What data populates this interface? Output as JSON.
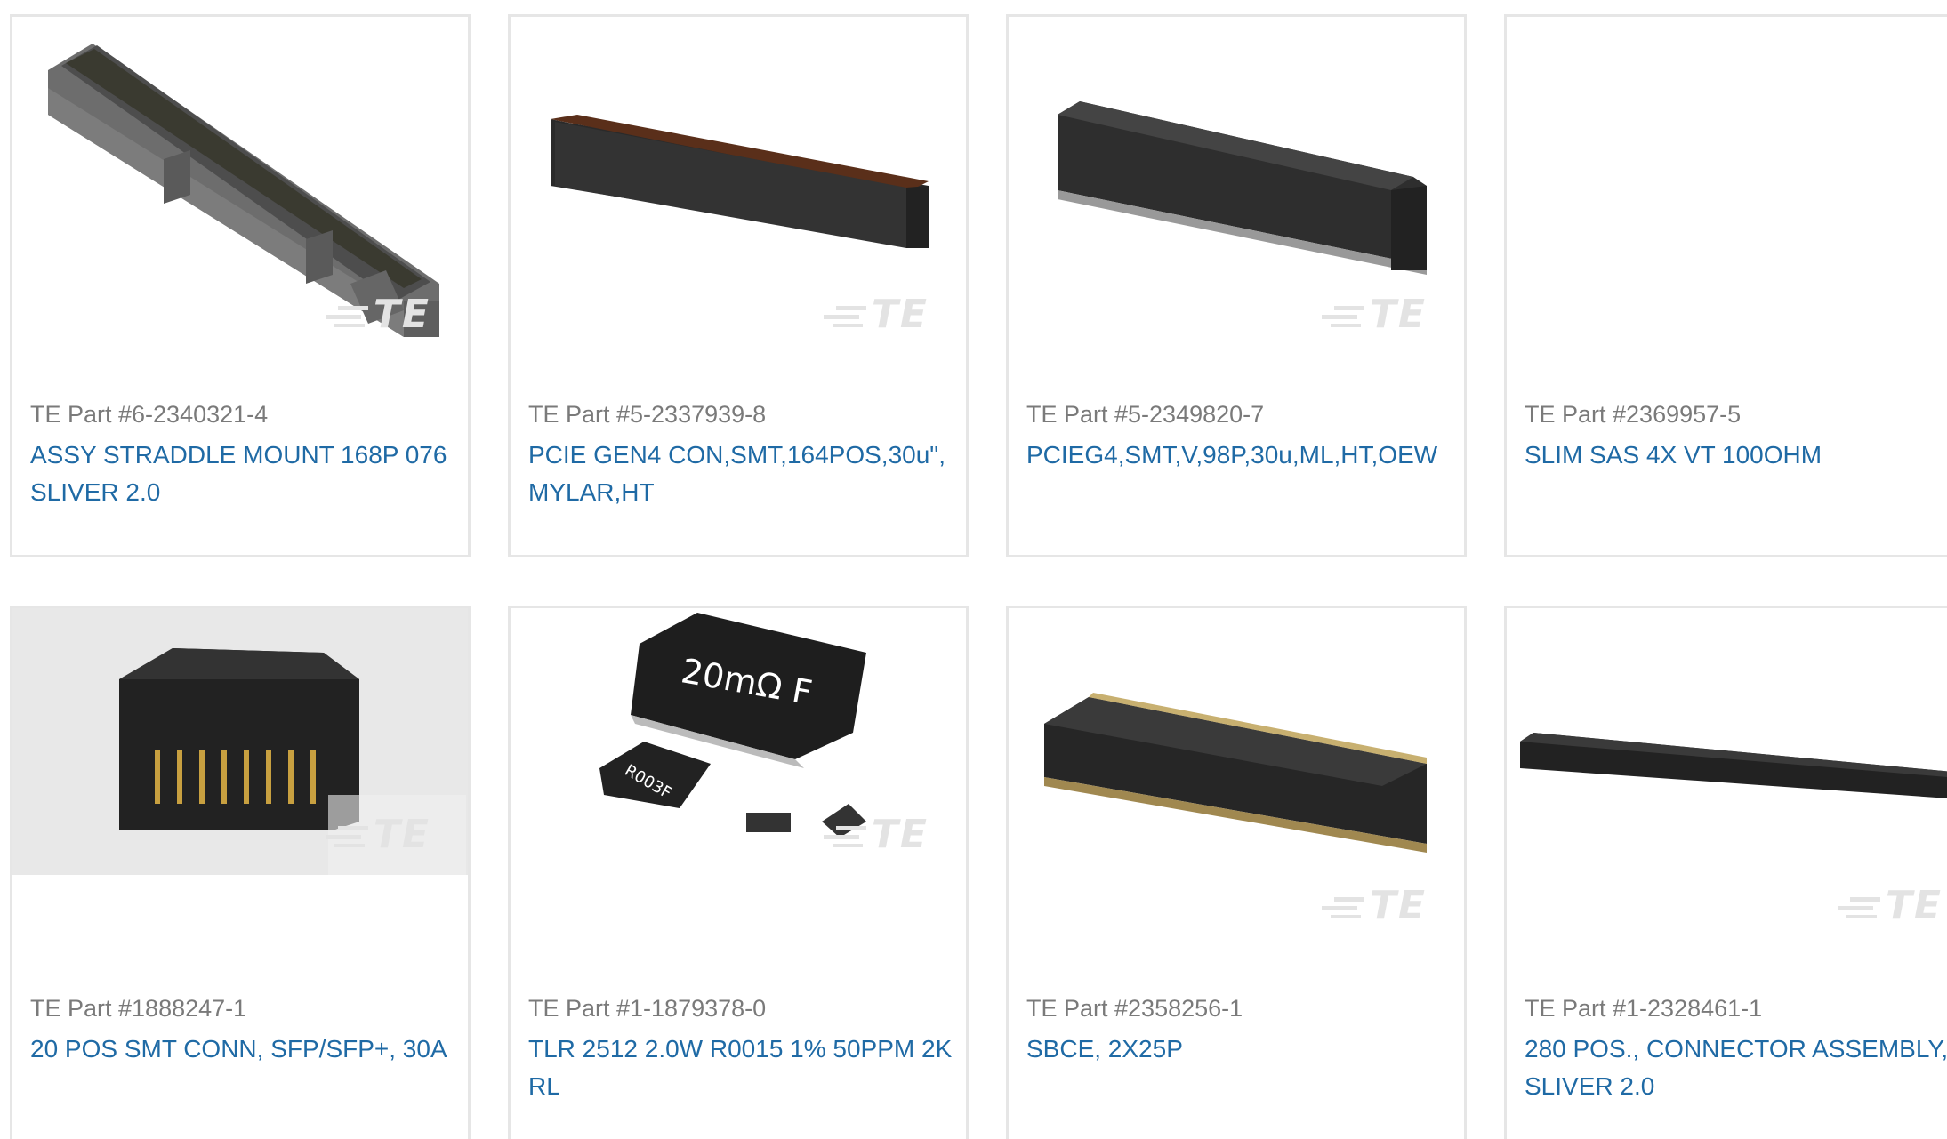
{
  "products": [
    {
      "part_number": "TE Part #6-2340321-4",
      "description": "ASSY STRADDLE MOUNT 168P 076 SLIVER 2.0",
      "image_icon": "straddle-mount-connector-image"
    },
    {
      "part_number": "TE Part #5-2337939-8",
      "description": "PCIE GEN4 CON,SMT,164POS,30u\", MYLAR,HT",
      "image_icon": "pcie-connector-image"
    },
    {
      "part_number": "TE Part #5-2349820-7",
      "description": "PCIEG4,SMT,V,98P,30u,ML,HT,OEW",
      "image_icon": "pcie-vertical-connector-image"
    },
    {
      "part_number": "TE Part #2369957-5",
      "description": "SLIM SAS 4X VT 100OHM",
      "image_icon": "slim-sas-connector-image"
    },
    {
      "part_number": "TE Part #1888247-1",
      "description": "20 POS SMT CONN, SFP/SFP+, 30A",
      "image_icon": "sfp-connector-image"
    },
    {
      "part_number": "TE Part #1-1879378-0",
      "description": "TLR 2512 2.0W R0015 1% 50PPM 2K RL",
      "image_icon": "resistor-image",
      "resistor_label_1": "20mΩ F",
      "resistor_label_2": "R003F"
    },
    {
      "part_number": "TE Part #2358256-1",
      "description": "SBCE, 2X25P",
      "image_icon": "card-edge-connector-image"
    },
    {
      "part_number": "TE Part #1-2328461-1",
      "description": "280 POS., CONNECTOR ASSEMBLY, SLIVER 2.0",
      "image_icon": "sliver-connector-image"
    }
  ],
  "watermark": "TE",
  "colors": {
    "link": "#1f6aa5",
    "part_number": "#7a7a7a",
    "border": "#e6e6e6"
  }
}
